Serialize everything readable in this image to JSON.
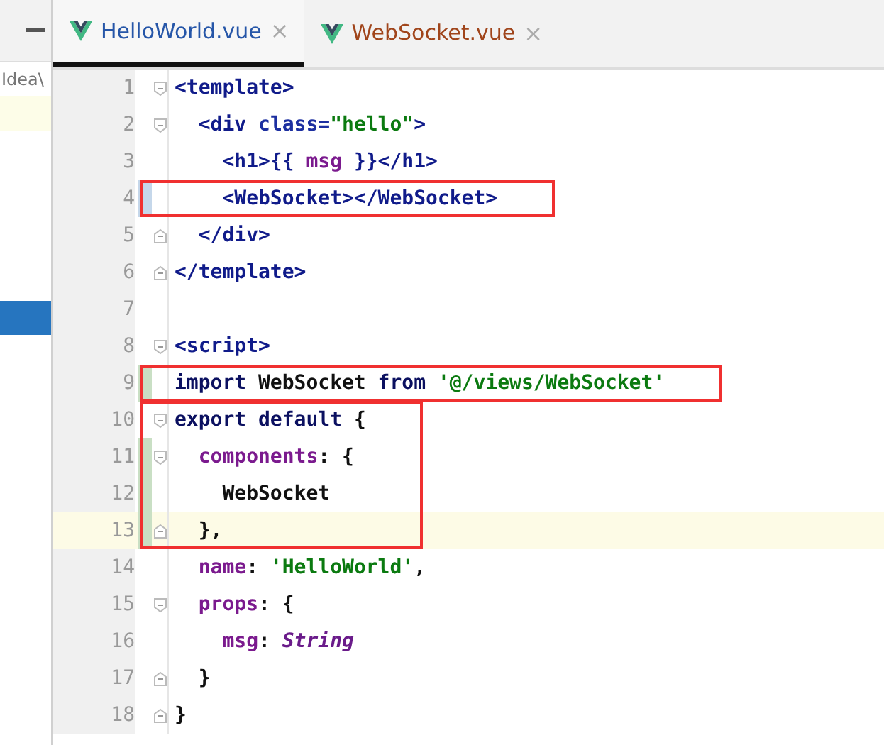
{
  "sidebar": {
    "path_fragment": "Idea\\",
    "rows": [
      {
        "selected": false,
        "highlighted": true
      },
      {
        "selected": true,
        "highlighted": false
      }
    ]
  },
  "tabs": [
    {
      "label": "HelloWorld.vue",
      "selected": true,
      "color": "#2656a8",
      "close": "×"
    },
    {
      "label": "WebSocket.vue",
      "selected": false,
      "color": "#a0451b",
      "close": "×"
    }
  ],
  "code_blocks": [
    {
      "boxed": false,
      "lines": [
        {
          "number": "1",
          "fold_start": true,
          "fold_end": false,
          "modified": false,
          "added": false,
          "current": false,
          "tokens": [
            {
              "kind": "tag",
              "text": "<template>"
            }
          ]
        },
        {
          "number": "2",
          "fold_start": true,
          "fold_end": false,
          "modified": false,
          "added": false,
          "current": false,
          "tokens": [
            {
              "kind": "tag",
              "text": "  <div "
            },
            {
              "kind": "attr",
              "text": "class="
            },
            {
              "kind": "string",
              "text": "\"hello\""
            },
            {
              "kind": "tag",
              "text": ">"
            }
          ]
        },
        {
          "number": "3",
          "fold_start": false,
          "fold_end": false,
          "modified": false,
          "added": false,
          "current": false,
          "tokens": [
            {
              "kind": "tag",
              "text": "    <h1>{{ "
            },
            {
              "kind": "prop",
              "text": "msg"
            },
            {
              "kind": "tag",
              "text": " }}</h1>"
            }
          ]
        }
      ]
    },
    {
      "boxed": true,
      "lines": [
        {
          "number": "4",
          "fold_start": false,
          "fold_end": false,
          "modified": true,
          "added": false,
          "current": false,
          "tokens": [
            {
              "kind": "tag",
              "text": "    <WebSocket></WebSocket>"
            }
          ]
        }
      ]
    },
    {
      "boxed": false,
      "lines": [
        {
          "number": "5",
          "fold_start": false,
          "fold_end": true,
          "modified": false,
          "added": false,
          "current": false,
          "tokens": [
            {
              "kind": "tag",
              "text": "  </div>"
            }
          ]
        },
        {
          "number": "6",
          "fold_start": false,
          "fold_end": true,
          "modified": false,
          "added": false,
          "current": false,
          "tokens": [
            {
              "kind": "tag",
              "text": "</template>"
            }
          ]
        },
        {
          "number": "7",
          "fold_start": false,
          "fold_end": false,
          "modified": false,
          "added": false,
          "current": false
        },
        {
          "number": "8",
          "fold_start": true,
          "fold_end": false,
          "modified": false,
          "added": false,
          "current": false,
          "tokens": [
            {
              "kind": "tag",
              "text": "<script>"
            }
          ]
        }
      ]
    },
    {
      "boxed": true,
      "lines": [
        {
          "number": "9",
          "fold_start": false,
          "fold_end": false,
          "modified": false,
          "added": true,
          "current": false,
          "tokens": [
            {
              "kind": "keyword",
              "text": "import"
            },
            {
              "kind": "plain",
              "text": " WebSocket "
            },
            {
              "kind": "keyword",
              "text": "from"
            },
            {
              "kind": "string",
              "text": " '@/views/WebSocket'"
            }
          ]
        }
      ]
    },
    {
      "boxed": true,
      "lines": [
        {
          "number": "10",
          "fold_start": true,
          "fold_end": false,
          "modified": false,
          "added": false,
          "current": false,
          "tokens": [
            {
              "kind": "keyword",
              "text": "export default"
            },
            {
              "kind": "plain",
              "text": " {"
            }
          ]
        },
        {
          "number": "11",
          "fold_start": true,
          "fold_end": false,
          "modified": false,
          "added": true,
          "current": false,
          "tokens": [
            {
              "kind": "prop",
              "text": "  components"
            },
            {
              "kind": "plain",
              "text": ": {"
            }
          ]
        },
        {
          "number": "12",
          "fold_start": false,
          "fold_end": false,
          "modified": false,
          "added": true,
          "current": false,
          "tokens": [
            {
              "kind": "plain",
              "text": "    WebSocket"
            }
          ]
        },
        {
          "number": "13",
          "fold_start": false,
          "fold_end": true,
          "modified": false,
          "added": true,
          "current": true,
          "tokens": [
            {
              "kind": "plain",
              "text": "  },"
            }
          ]
        }
      ]
    },
    {
      "boxed": false,
      "lines": [
        {
          "number": "14",
          "fold_start": false,
          "fold_end": false,
          "modified": false,
          "added": false,
          "current": false,
          "tokens": [
            {
              "kind": "prop",
              "text": "  name"
            },
            {
              "kind": "plain",
              "text": ": "
            },
            {
              "kind": "string",
              "text": "'HelloWorld'"
            },
            {
              "kind": "plain",
              "text": ","
            }
          ]
        },
        {
          "number": "15",
          "fold_start": true,
          "fold_end": false,
          "modified": false,
          "added": false,
          "current": false,
          "tokens": [
            {
              "kind": "prop",
              "text": "  props"
            },
            {
              "kind": "plain",
              "text": ": {"
            }
          ]
        },
        {
          "number": "16",
          "fold_start": false,
          "fold_end": false,
          "modified": false,
          "added": false,
          "current": false,
          "tokens": [
            {
              "kind": "prop",
              "text": "    msg"
            },
            {
              "kind": "plain",
              "text": ": "
            },
            {
              "kind": "type",
              "text": "String"
            }
          ]
        },
        {
          "number": "17",
          "fold_start": false,
          "fold_end": true,
          "modified": false,
          "added": false,
          "current": false,
          "tokens": [
            {
              "kind": "plain",
              "text": "  }"
            }
          ]
        },
        {
          "number": "18",
          "fold_start": false,
          "fold_end": true,
          "modified": false,
          "added": false,
          "current": false,
          "tokens": [
            {
              "kind": "plain",
              "text": "}"
            }
          ]
        }
      ]
    }
  ]
}
